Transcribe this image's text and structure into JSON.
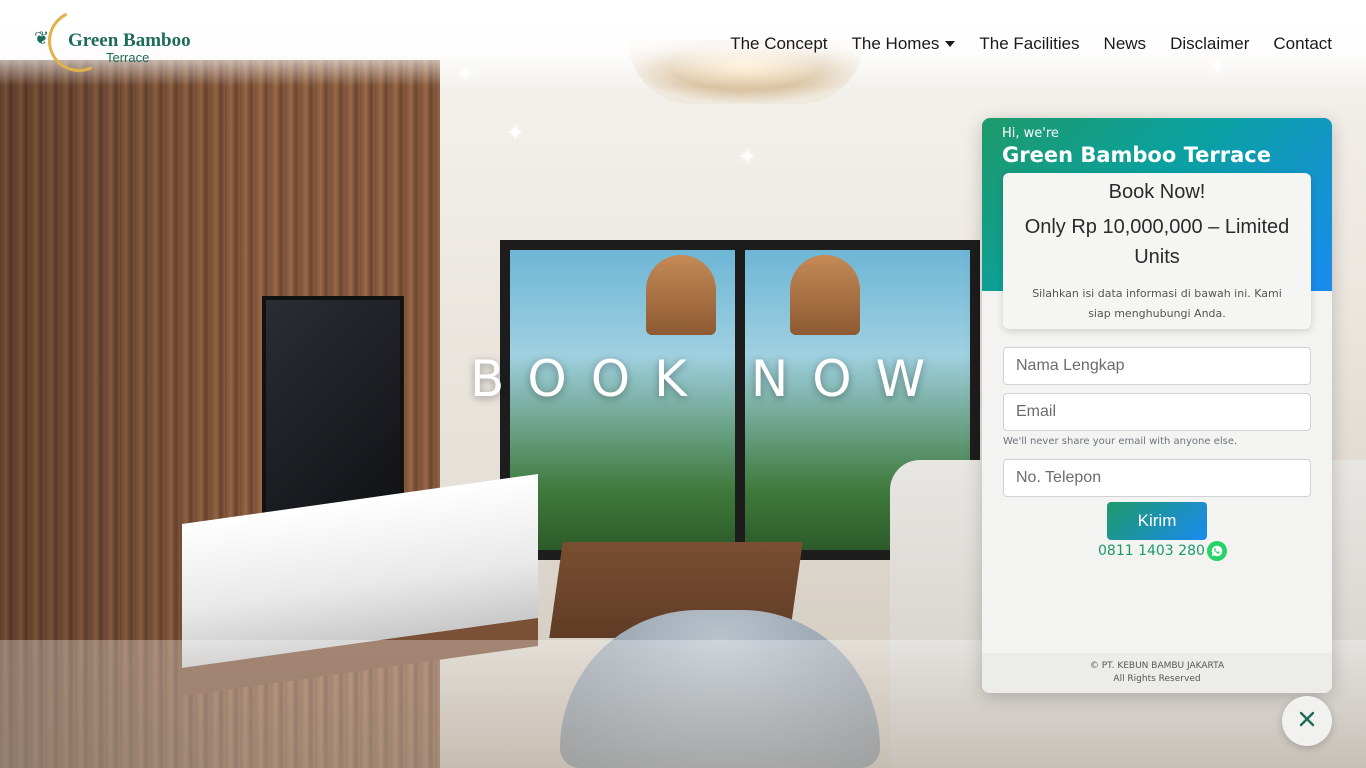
{
  "logo": {
    "name": "Green Bamboo",
    "sub": "Terrace"
  },
  "nav": {
    "items": [
      {
        "label": "The Concept"
      },
      {
        "label": "The Homes",
        "has_dropdown": true
      },
      {
        "label": "The Facilities"
      },
      {
        "label": "News"
      },
      {
        "label": "Disclaimer"
      },
      {
        "label": "Contact"
      }
    ]
  },
  "hero": {
    "headline": "BOOK NOW"
  },
  "form_panel": {
    "greeting": "Hi, we're",
    "brand": "Green Bamboo Terrace",
    "card_title": "Book Now!",
    "card_offer": "Only Rp 10,000,000 – Limited Units",
    "card_note": "Silahkan isi data informasi di bawah ini. Kami siap menghubungi Anda.",
    "name_placeholder": "Nama Lengkap",
    "email_placeholder": "Email",
    "email_help": "We'll never share your email with anyone else.",
    "phone_placeholder": "No. Telepon",
    "submit_label": "Kirim",
    "whatsapp_number": "0811 1403 280",
    "copyright_line1": "© PT. KEBUN BAMBU JAKARTA",
    "copyright_line2": "All Rights Reserved"
  },
  "icons": {
    "whatsapp": "whatsapp-icon",
    "close": "close-icon",
    "dropdown": "chevron-down-icon"
  },
  "colors": {
    "brand_green": "#1f6b5a",
    "accent_gradient_start": "#1e9a6a",
    "accent_gradient_end": "#1a8af0",
    "whatsapp_green": "#25d366"
  }
}
